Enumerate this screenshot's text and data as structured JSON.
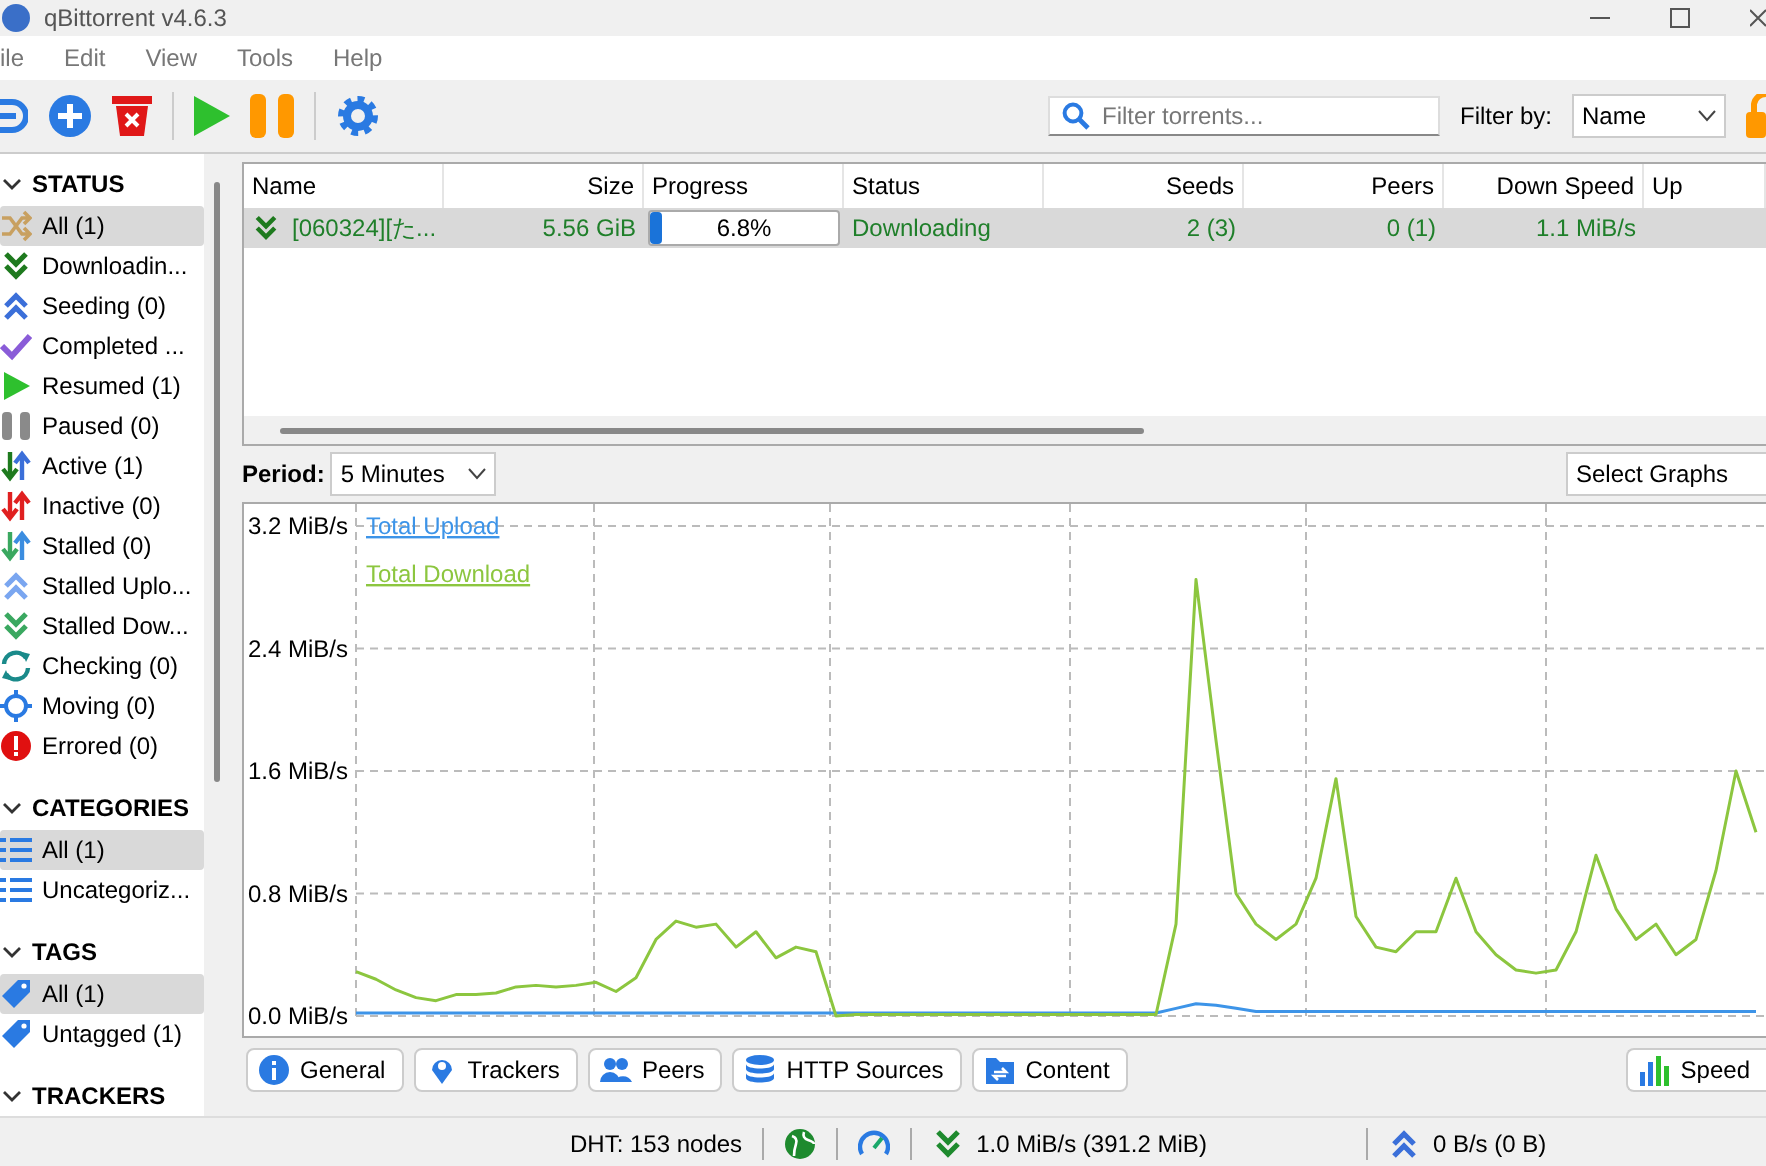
{
  "window": {
    "title": "qBittorrent v4.6.3"
  },
  "menu": [
    "ile",
    "Edit",
    "View",
    "Tools",
    "Help"
  ],
  "toolbar": {
    "search": {
      "placeholder": "Filter torrents..."
    },
    "filter_label": "Filter by:",
    "filter_value": "Name"
  },
  "sidebar": [
    {
      "title": "STATUS",
      "expanded": true,
      "items": [
        {
          "label": "All (1)",
          "selected": true
        },
        {
          "label": "Downloadin...",
          "selected": false
        },
        {
          "label": "Seeding (0)",
          "selected": false
        },
        {
          "label": "Completed ...",
          "selected": false
        },
        {
          "label": "Resumed (1)",
          "selected": false
        },
        {
          "label": "Paused (0)",
          "selected": false
        },
        {
          "label": "Active (1)",
          "selected": false
        },
        {
          "label": "Inactive (0)",
          "selected": false
        },
        {
          "label": "Stalled (0)",
          "selected": false
        },
        {
          "label": "Stalled Uplo...",
          "selected": false
        },
        {
          "label": "Stalled Dow...",
          "selected": false
        },
        {
          "label": "Checking (0)",
          "selected": false
        },
        {
          "label": "Moving (0)",
          "selected": false
        },
        {
          "label": "Errored (0)",
          "selected": false
        }
      ]
    },
    {
      "title": "CATEGORIES",
      "expanded": true,
      "items": [
        {
          "label": "All (1)",
          "selected": true
        },
        {
          "label": "Uncategoriz...",
          "selected": false
        }
      ]
    },
    {
      "title": "TAGS",
      "expanded": true,
      "items": [
        {
          "label": "All (1)",
          "selected": true
        },
        {
          "label": "Untagged (1)",
          "selected": false
        }
      ]
    },
    {
      "title": "TRACKERS",
      "expanded": true
    }
  ],
  "table": {
    "columns": [
      "Name",
      "Size",
      "Progress",
      "Status",
      "Seeds",
      "Peers",
      "Down Speed",
      "Up"
    ],
    "rows": [
      {
        "name": "[060324][た...",
        "size": "5.56 GiB",
        "progress": "6.8%",
        "level": 0.068,
        "status": "Downloading",
        "seeds": "2 (3)",
        "peers": "0 (1)",
        "down_speed": "1.1 MiB/s",
        "selected": true
      }
    ]
  },
  "graph": {
    "period_label": "Period:",
    "period": "5 Minutes",
    "select": "Select Graphs",
    "chart_data": {
      "type": "line",
      "grid": true,
      "ylim": [
        0,
        3.2
      ],
      "yticks": [
        {
          "value": 0,
          "label": "0.0 MiB/s"
        },
        {
          "value": 0.8,
          "label": "0.8 MiB/s"
        },
        {
          "value": 1.6,
          "label": "1.6 MiB/s"
        },
        {
          "value": 2.4,
          "label": "2.4 MiB/s"
        },
        {
          "value": 3.2,
          "label": "3.2 MiB/s"
        }
      ],
      "series": [
        {
          "name": "Total Upload",
          "color": "#3d94e8",
          "values": [
            0.02,
            0.02,
            0.02,
            0.02,
            0.02,
            0.02,
            0.02,
            0.02,
            0.02,
            0.02,
            0.02,
            0.02,
            0.02,
            0.02,
            0.02,
            0.02,
            0.02,
            0.02,
            0.02,
            0.02,
            0.02,
            0.02,
            0.02,
            0.02,
            0.02,
            0.02,
            0.02,
            0.02,
            0.02,
            0.02,
            0.02,
            0.02,
            0.02,
            0.02,
            0.02,
            0.02,
            0.02,
            0.02,
            0.02,
            0.02,
            0.02,
            0.05,
            0.08,
            0.07,
            0.05,
            0.03,
            0.03,
            0.03,
            0.03,
            0.03,
            0.03,
            0.03,
            0.03,
            0.03,
            0.03,
            0.03,
            0.03,
            0.03,
            0.03,
            0.03,
            0.03,
            0.03,
            0.03,
            0.03,
            0.03,
            0.03,
            0.03,
            0.03,
            0.03,
            0.03,
            0.03
          ]
        },
        {
          "name": "Total Download",
          "color": "#8cc63f",
          "values": [
            0.29,
            0.24,
            0.17,
            0.12,
            0.1,
            0.14,
            0.14,
            0.15,
            0.19,
            0.2,
            0.19,
            0.2,
            0.22,
            0.16,
            0.25,
            0.5,
            0.62,
            0.58,
            0.6,
            0.45,
            0.55,
            0.38,
            0.45,
            0.42,
            0.0,
            0.01,
            0.01,
            0.01,
            0.01,
            0.01,
            0.01,
            0.01,
            0.01,
            0.01,
            0.01,
            0.01,
            0.01,
            0.01,
            0.01,
            0.01,
            0.01,
            0.6,
            2.85,
            1.8,
            0.8,
            0.6,
            0.5,
            0.6,
            0.9,
            1.55,
            0.65,
            0.45,
            0.42,
            0.55,
            0.55,
            0.9,
            0.55,
            0.4,
            0.3,
            0.28,
            0.3,
            0.55,
            1.05,
            0.7,
            0.5,
            0.6,
            0.4,
            0.5,
            0.95,
            1.6,
            1.2
          ]
        }
      ]
    }
  },
  "tabs": [
    "General",
    "Trackers",
    "Peers",
    "HTTP Sources",
    "Content"
  ],
  "speed_button": "Speed",
  "status_bar": {
    "dht": "DHT: 153 nodes",
    "download": "1.0 MiB/s (391.2 MiB)",
    "upload": "0 B/s (0 B)"
  }
}
